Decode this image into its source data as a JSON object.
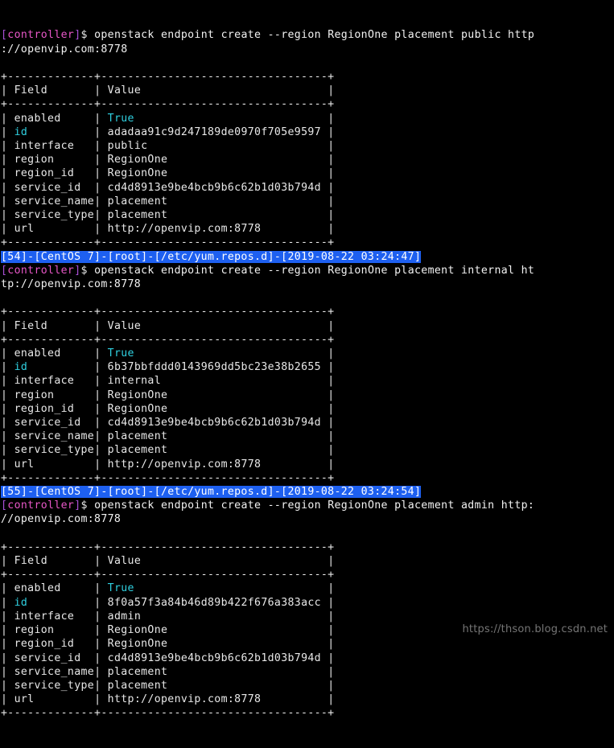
{
  "terminal": {
    "title": "Terminal — openstack endpoint create",
    "background_color": "#000000",
    "foreground_color": "#d8d8d8",
    "highlight_background_color": "#1e60f0",
    "highlight_foreground_color": "#ffffff",
    "prompt_bracket_color": "#a94fd6",
    "prompt_host_color": "#e857c8",
    "key_accent_color": "#2fd0e0",
    "value_accent_color": "#2fd0e0"
  },
  "watermark": {
    "text": "https://thson.blog.csdn.net"
  },
  "blocks": [
    {
      "id": "block-public",
      "status_line": null,
      "prompt": {
        "open_bracket": "[",
        "host": "controller",
        "close_bracket": "]",
        "dollar": "$ "
      },
      "command_line_1": "openstack endpoint create --region RegionOne placement public http",
      "command_line_2": "://openvip.com:8778",
      "table": {
        "rule_top": "+-------------+----------------------------------+",
        "header_row": "| Field       | Value                            |",
        "rule_mid": "+-------------+----------------------------------+",
        "rule_bottom": "+-------------+----------------------------------+",
        "header_field": "Field",
        "header_value": "Value",
        "rows": [
          {
            "field": "enabled",
            "value": "True",
            "field_accent": false,
            "value_accent": true
          },
          {
            "field": "id",
            "value": "adadaa91c9d247189de0970f705e9597",
            "field_accent": true,
            "value_accent": false
          },
          {
            "field": "interface",
            "value": "public",
            "field_accent": false,
            "value_accent": false
          },
          {
            "field": "region",
            "value": "RegionOne",
            "field_accent": false,
            "value_accent": false
          },
          {
            "field": "region_id",
            "value": "RegionOne",
            "field_accent": false,
            "value_accent": false
          },
          {
            "field": "service_id",
            "value": "cd4d8913e9be4bcb9b6c62b1d03b794d",
            "field_accent": false,
            "value_accent": false
          },
          {
            "field": "service_name",
            "value": "placement",
            "field_accent": false,
            "value_accent": false
          },
          {
            "field": "service_type",
            "value": "placement",
            "field_accent": false,
            "value_accent": false
          },
          {
            "field": "url",
            "value": "http://openvip.com:8778",
            "field_accent": false,
            "value_accent": false
          }
        ]
      }
    },
    {
      "id": "block-internal",
      "status_line": "[54]-[CentOS 7]-[root]-[/etc/yum.repos.d]-[2019-08-22 03:24:47]",
      "status_parts": {
        "index": "54",
        "os": "CentOS 7",
        "user": "root",
        "cwd": "/etc/yum.repos.d",
        "timestamp": "2019-08-22 03:24:47"
      },
      "prompt": {
        "open_bracket": "[",
        "host": "controller",
        "close_bracket": "]",
        "dollar": "$ "
      },
      "command_line_1": "openstack endpoint create --region RegionOne placement internal ht",
      "command_line_2": "tp://openvip.com:8778",
      "table": {
        "rule_top": "+-------------+----------------------------------+",
        "header_row": "| Field       | Value                            |",
        "rule_mid": "+-------------+----------------------------------+",
        "rule_bottom": "+-------------+----------------------------------+",
        "header_field": "Field",
        "header_value": "Value",
        "rows": [
          {
            "field": "enabled",
            "value": "True",
            "field_accent": false,
            "value_accent": true
          },
          {
            "field": "id",
            "value": "6b37bbfddd0143969dd5bc23e38b2655",
            "field_accent": true,
            "value_accent": false
          },
          {
            "field": "interface",
            "value": "internal",
            "field_accent": false,
            "value_accent": false
          },
          {
            "field": "region",
            "value": "RegionOne",
            "field_accent": false,
            "value_accent": false
          },
          {
            "field": "region_id",
            "value": "RegionOne",
            "field_accent": false,
            "value_accent": false
          },
          {
            "field": "service_id",
            "value": "cd4d8913e9be4bcb9b6c62b1d03b794d",
            "field_accent": false,
            "value_accent": false
          },
          {
            "field": "service_name",
            "value": "placement",
            "field_accent": false,
            "value_accent": false
          },
          {
            "field": "service_type",
            "value": "placement",
            "field_accent": false,
            "value_accent": false
          },
          {
            "field": "url",
            "value": "http://openvip.com:8778",
            "field_accent": false,
            "value_accent": false
          }
        ]
      }
    },
    {
      "id": "block-admin",
      "status_line": "[55]-[CentOS 7]-[root]-[/etc/yum.repos.d]-[2019-08-22 03:24:54]",
      "status_parts": {
        "index": "55",
        "os": "CentOS 7",
        "user": "root",
        "cwd": "/etc/yum.repos.d",
        "timestamp": "2019-08-22 03:24:54"
      },
      "prompt": {
        "open_bracket": "[",
        "host": "controller",
        "close_bracket": "]",
        "dollar": "$ "
      },
      "command_line_1": "openstack endpoint create --region RegionOne placement admin http:",
      "command_line_2": "//openvip.com:8778",
      "table": {
        "rule_top": "+-------------+----------------------------------+",
        "header_row": "| Field       | Value                            |",
        "rule_mid": "+-------------+----------------------------------+",
        "rule_bottom": "+-------------+----------------------------------+",
        "header_field": "Field",
        "header_value": "Value",
        "rows": [
          {
            "field": "enabled",
            "value": "True",
            "field_accent": false,
            "value_accent": true
          },
          {
            "field": "id",
            "value": "8f0a57f3a84b46d89b422f676a383acc",
            "field_accent": true,
            "value_accent": false
          },
          {
            "field": "interface",
            "value": "admin",
            "field_accent": false,
            "value_accent": false
          },
          {
            "field": "region",
            "value": "RegionOne",
            "field_accent": false,
            "value_accent": false
          },
          {
            "field": "region_id",
            "value": "RegionOne",
            "field_accent": false,
            "value_accent": false
          },
          {
            "field": "service_id",
            "value": "cd4d8913e9be4bcb9b6c62b1d03b794d",
            "field_accent": false,
            "value_accent": false
          },
          {
            "field": "service_name",
            "value": "placement",
            "field_accent": false,
            "value_accent": false
          },
          {
            "field": "service_type",
            "value": "placement",
            "field_accent": false,
            "value_accent": false
          },
          {
            "field": "url",
            "value": "http://openvip.com:8778",
            "field_accent": false,
            "value_accent": false
          }
        ]
      }
    }
  ]
}
